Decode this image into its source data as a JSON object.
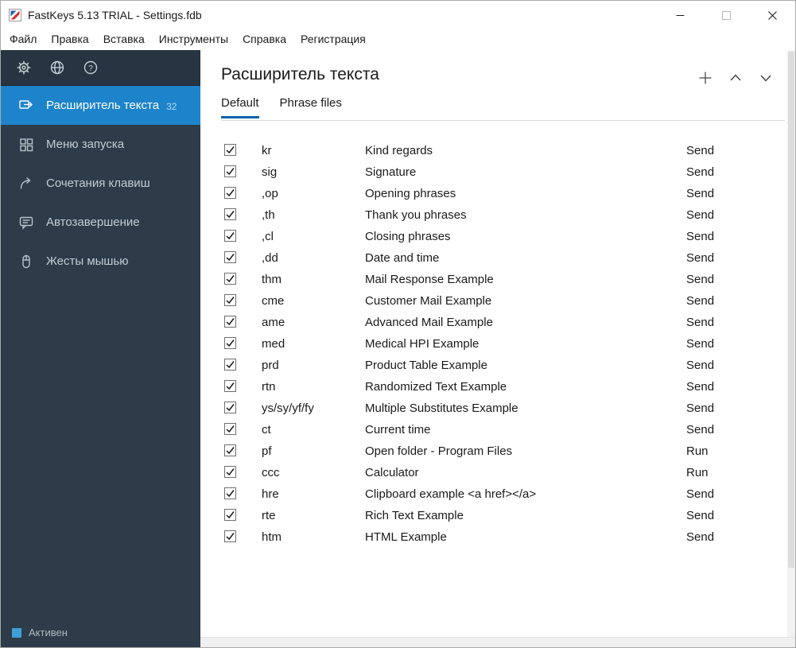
{
  "window": {
    "title": "FastKeys 5.13 TRIAL - Settings.fdb",
    "controls": [
      {
        "name": "minimize"
      },
      {
        "name": "maximize"
      },
      {
        "name": "close"
      }
    ]
  },
  "menu": {
    "items": [
      "Файл",
      "Правка",
      "Вставка",
      "Инструменты",
      "Справка",
      "Регистрация"
    ]
  },
  "sidebar": {
    "top_icons": [
      {
        "name": "settings-icon"
      },
      {
        "name": "globe-icon"
      },
      {
        "name": "help-icon"
      }
    ],
    "items": [
      {
        "label": "Расширитель текста",
        "badge": "32",
        "active": true,
        "icon": "text-expander-icon"
      },
      {
        "label": "Меню запуска",
        "active": false,
        "icon": "start-menu-icon"
      },
      {
        "label": "Сочетания клавиш",
        "active": false,
        "icon": "shortcuts-icon"
      },
      {
        "label": "Автозавершение",
        "active": false,
        "icon": "autocomplete-icon"
      },
      {
        "label": "Жесты мышью",
        "active": false,
        "icon": "mouse-gestures-icon"
      }
    ],
    "status": {
      "label": "Активен",
      "indicator_color": "#3f9fd8"
    }
  },
  "main": {
    "title": "Расширитель текста",
    "actions": [
      {
        "name": "add"
      },
      {
        "name": "move-up"
      },
      {
        "name": "move-down"
      }
    ],
    "tabs": [
      {
        "label": "Default",
        "active": true
      },
      {
        "label": "Phrase files",
        "active": false
      }
    ],
    "table": {
      "rows": [
        {
          "checked": true,
          "abbr": "kr",
          "desc": "Kind regards",
          "action": "Send"
        },
        {
          "checked": true,
          "abbr": "sig",
          "desc": "Signature",
          "action": "Send"
        },
        {
          "checked": true,
          "abbr": ",op",
          "desc": "Opening phrases",
          "action": "Send"
        },
        {
          "checked": true,
          "abbr": ",th",
          "desc": "Thank you phrases",
          "action": "Send"
        },
        {
          "checked": true,
          "abbr": ",cl",
          "desc": "Closing phrases",
          "action": "Send"
        },
        {
          "checked": true,
          "abbr": ",dd",
          "desc": "Date and time",
          "action": "Send"
        },
        {
          "checked": true,
          "abbr": "thm",
          "desc": "Mail Response Example",
          "action": "Send"
        },
        {
          "checked": true,
          "abbr": "cme",
          "desc": "Customer Mail Example",
          "action": "Send"
        },
        {
          "checked": true,
          "abbr": "ame",
          "desc": "Advanced Mail Example",
          "action": "Send"
        },
        {
          "checked": true,
          "abbr": "med",
          "desc": "Medical HPI Example",
          "action": "Send"
        },
        {
          "checked": true,
          "abbr": "prd",
          "desc": "Product Table Example",
          "action": "Send"
        },
        {
          "checked": true,
          "abbr": "rtn",
          "desc": "Randomized Text Example",
          "action": "Send"
        },
        {
          "checked": true,
          "abbr": "ys/sy/yf/fy",
          "desc": "Multiple Substitutes Example",
          "action": "Send"
        },
        {
          "checked": true,
          "abbr": "ct",
          "desc": "Current time",
          "action": "Send"
        },
        {
          "checked": true,
          "abbr": "pf",
          "desc": "Open folder - Program Files",
          "action": "Run"
        },
        {
          "checked": true,
          "abbr": "ccc",
          "desc": "Calculator",
          "action": "Run"
        },
        {
          "checked": true,
          "abbr": "hre",
          "desc": "Clipboard example <a href></a>",
          "action": "Send"
        },
        {
          "checked": true,
          "abbr": "rte",
          "desc": "Rich Text Example",
          "action": "Send"
        },
        {
          "checked": true,
          "abbr": "htm",
          "desc": "HTML Example",
          "action": "Send"
        }
      ]
    }
  },
  "colors": {
    "accent": "#1d83cb",
    "sidebar_bg": "#2d3c48",
    "tab_underline": "#0c64a8"
  }
}
